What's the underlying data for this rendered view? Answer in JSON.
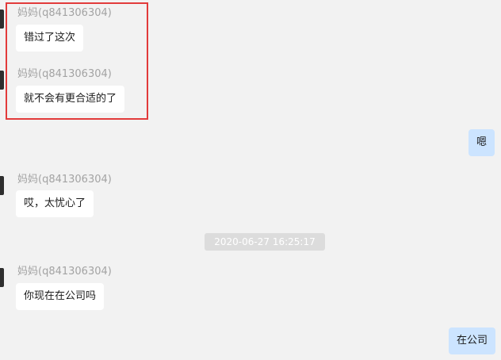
{
  "chat": {
    "messages": [
      {
        "direction": "in",
        "sender": "妈妈(q841306304)",
        "text": "错过了这次"
      },
      {
        "direction": "in",
        "sender": "妈妈(q841306304)",
        "text": "就不会有更合适的了"
      },
      {
        "direction": "out",
        "text": "嗯"
      },
      {
        "direction": "in",
        "sender": "妈妈(q841306304)",
        "text": "哎，太忧心了"
      },
      {
        "direction": "in",
        "sender": "妈妈(q841306304)",
        "text": "你现在在公司吗"
      },
      {
        "direction": "out",
        "text": "在公司"
      }
    ],
    "timestamp": "2020-06-27 16:25:17"
  },
  "colors": {
    "background": "#f2f2f2",
    "incoming_bubble": "#ffffff",
    "outgoing_bubble": "#cce4ff",
    "highlight_border": "#e23b3b",
    "sender_text": "#a3a3a3"
  }
}
